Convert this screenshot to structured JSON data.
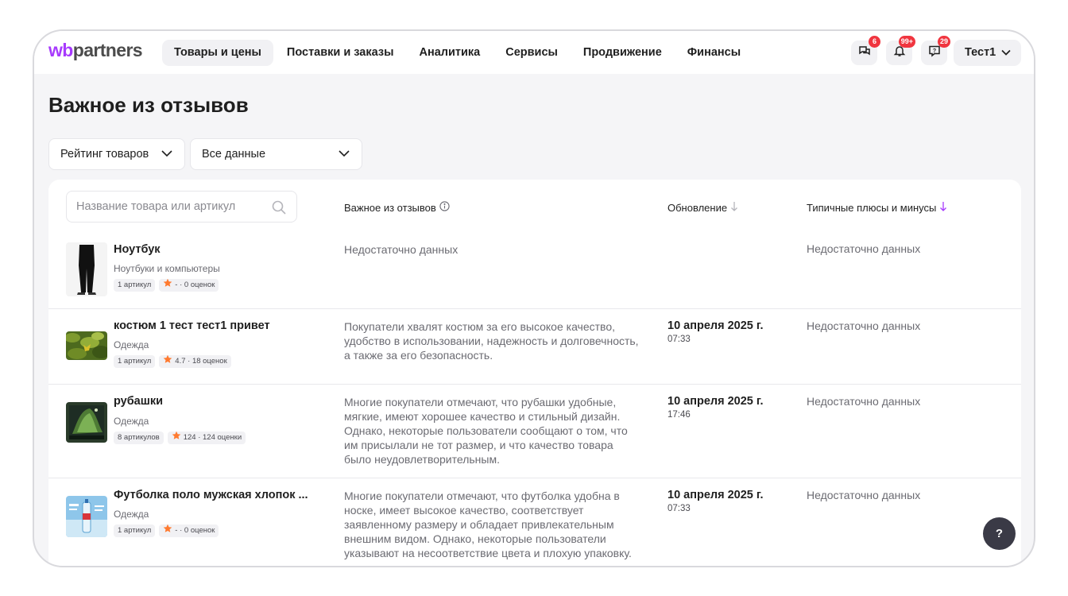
{
  "header": {
    "logo_wb": "wb",
    "logo_rest": "partners",
    "nav": [
      {
        "label": "Товары и цены",
        "active": true
      },
      {
        "label": "Поставки и заказы",
        "active": false
      },
      {
        "label": "Аналитика",
        "active": false
      },
      {
        "label": "Сервисы",
        "active": false
      },
      {
        "label": "Продвижение",
        "active": false
      },
      {
        "label": "Финансы",
        "active": false
      }
    ],
    "icons": [
      {
        "icon": "chat-icon",
        "badge": "6"
      },
      {
        "icon": "bell-icon",
        "badge": "99+"
      },
      {
        "icon": "help-chat-icon",
        "badge": "29"
      }
    ],
    "user": "Тест1"
  },
  "page": {
    "title": "Важное из отзывов",
    "filters": [
      "Рейтинг товаров",
      "Все данные"
    ]
  },
  "table": {
    "search_placeholder": "Название товара или артикул",
    "columns": {
      "summary": "Важное из отзывов",
      "updated": "Обновление",
      "pros_cons": "Типичные плюсы и минусы"
    },
    "rows": [
      {
        "name": "Ноутбук",
        "category": "Ноутбуки и компьютеры",
        "articles": "1 артикул",
        "rating": "- · 0 оценок",
        "summary": "Недостаточно данных",
        "date": "",
        "time": "",
        "pros_cons": "Недостаточно данных",
        "thumb": "pants"
      },
      {
        "name": "костюм 1 тест тест1 привет",
        "category": "Одежда",
        "articles": "1 артикул",
        "rating": "4.7 · 18 оценок",
        "summary": "Покупатели хвалят костюм за его высокое качество, удобство в использовании, надежность и долговечность, а также за его безопасность.",
        "date": "10 апреля 2025 г.",
        "time": "07:33",
        "pros_cons": "Недостаточно данных",
        "thumb": "leaves"
      },
      {
        "name": "рубашки",
        "category": "Одежда",
        "articles": "8 артикулов",
        "rating": "124 · 124 оценки",
        "summary": "Многие покупатели отмечают, что рубашки удобные, мягкие, имеют хорошее качество и стильный дизайн. Однако, некоторые пользователи сообщают о том, что им присылали не тот размер, и что качество товара было неудовлетворительным.",
        "date": "10 апреля 2025 г.",
        "time": "17:46",
        "pros_cons": "Недостаточно данных",
        "thumb": "aurora"
      },
      {
        "name": "Футболка поло мужская хлопок ...",
        "category": "Одежда",
        "articles": "1 артикул",
        "rating": "- · 0 оценок",
        "summary": "Многие покупатели отмечают, что футболка удобна в носке, имеет высокое качество, соответствует заявленному размеру и обладает привлекательным внешним видом. Однако, некоторые пользователи указывают на несоответствие цвета и плохую упаковку.",
        "date": "10 апреля 2025 г.",
        "time": "07:33",
        "pros_cons": "Недостаточно данных",
        "thumb": "bottle"
      }
    ]
  },
  "help_button": "?",
  "colors": {
    "brand": "#a73afd",
    "badge": "#f0353f",
    "star": "#ff7a2f"
  }
}
